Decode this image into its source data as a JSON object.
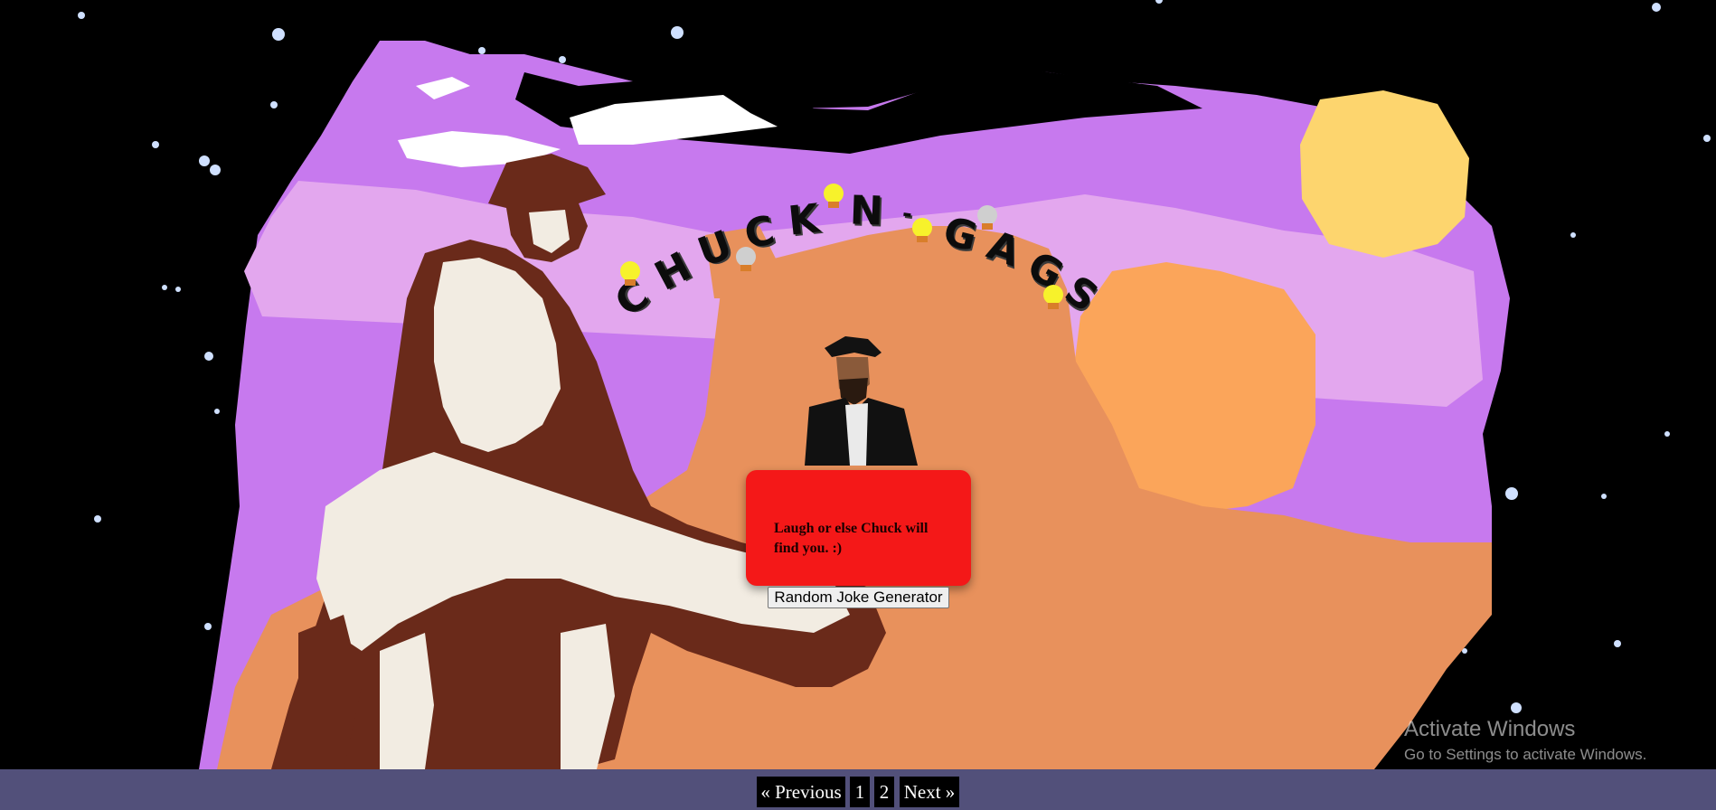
{
  "title": {
    "letters": [
      "C",
      "H",
      "U",
      "C",
      "K",
      "N",
      "-",
      "G",
      "A",
      "G",
      "S"
    ]
  },
  "joke": {
    "text": "Laugh or else Chuck will find you. :)"
  },
  "joke_button": {
    "label": "Random Joke Generator"
  },
  "pagination": {
    "previous": "« Previous",
    "pages": [
      "1",
      "2"
    ],
    "next": "Next »"
  },
  "watermark": {
    "title": "Activate Windows",
    "subtitle": "Go to Settings to activate Windows."
  },
  "colors": {
    "sky": "#000000",
    "purple": "#c779ee",
    "orange": "#e8915c",
    "sun": "#fdd56e",
    "joke_box": "#f41818",
    "footer": "#52507a"
  }
}
